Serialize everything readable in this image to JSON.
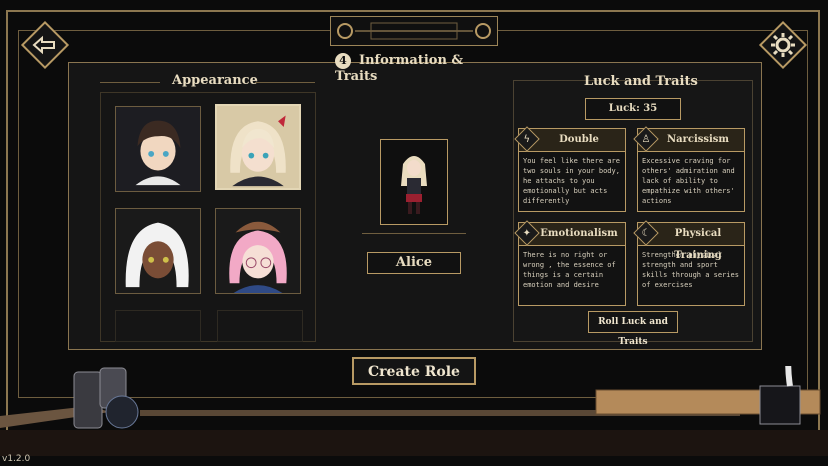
{
  "header": {
    "step_number": "4",
    "title": "Information & Traits",
    "back_icon": "back-arrow-icon",
    "settings_icon": "gear-icon"
  },
  "appearance": {
    "title": "Appearance",
    "portraits": [
      {
        "name": "dark-haired-boy",
        "selected": false
      },
      {
        "name": "blonde-girl-red-bow",
        "selected": true
      },
      {
        "name": "white-haired-dark-skin",
        "selected": false
      },
      {
        "name": "pink-haired-glasses-girl",
        "selected": false
      }
    ]
  },
  "character": {
    "name": "Alice"
  },
  "traits_panel": {
    "title": "Luck and Traits",
    "luck_label": "Luck: 35",
    "traits": [
      {
        "name": "Double",
        "icon": "lightning-icon",
        "description": "You feel like there are two souls in your body, he attachs to you emotionally but acts differently"
      },
      {
        "name": "Narcissism",
        "icon": "person-icon",
        "description": "Excessive craving for others' admiration and lack of ability to empathize with others' actions"
      },
      {
        "name": "Emotionalism",
        "icon": "sparkle-icon",
        "description": "There is no right or wrong , the essence of things is a certain emotion and desire"
      },
      {
        "name": "Physical Training",
        "icon": "moon-icon",
        "description": "Strengthen physical strength and sport skills through a series of exercises"
      }
    ],
    "roll_button": "Roll Luck and Traits"
  },
  "create_button": "Create Role",
  "version": "v1.2.0",
  "colors": {
    "gold": "#b89a64",
    "background": "#0b0b0b",
    "panel": "#151515",
    "text": "#e8dcc0"
  }
}
